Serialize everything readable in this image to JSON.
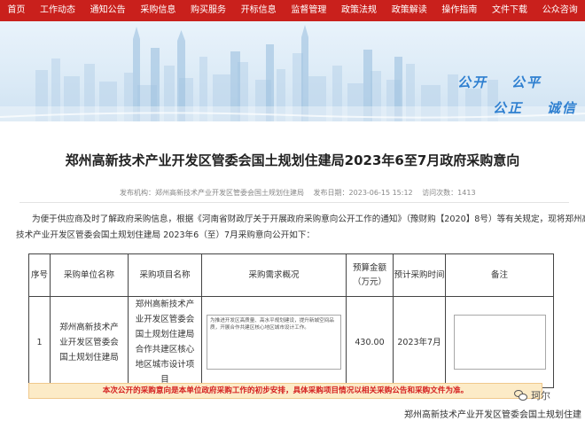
{
  "nav": {
    "items": [
      "首页",
      "工作动态",
      "通知公告",
      "采购信息",
      "购买服务",
      "开标信息",
      "监督管理",
      "政策法规",
      "政策解读",
      "操作指南",
      "文件下载",
      "公众咨询"
    ]
  },
  "banner": {
    "slogan_1": "公开",
    "slogan_2": "公平",
    "slogan_3": "公正",
    "slogan_4": "诚信"
  },
  "article": {
    "title": "郑州高新技术产业开发区管委会国土规划住建局2023年6至7月政府采购意向",
    "publisher": "发布机构：郑州高新技术产业开发区管委会国土规划住建局",
    "date": "发布日期：2023-06-15 15:12",
    "views": "访问次数：1413",
    "intro_line_1": "为便于供应商及时了解政府采购信息，根据《河南省财政厅关于开展政府采购意向公开工作的通知》（豫财购【2020】8号）等有关规定，现将郑州高新",
    "intro_line_2": "技术产业开发区管委会国土规划住建局 2023年6（至）7月采购意向公开如下："
  },
  "table": {
    "headers": {
      "seq": "序号",
      "unit": "采购单位名称",
      "project": "采购项目名称",
      "requirement": "采购需求概况",
      "amount": "预算金额（万元）",
      "time": "预计采购时间",
      "note": "备注"
    },
    "rows": [
      {
        "seq": "1",
        "unit": "郑州高新技术产业开发区管委会国土规划住建局",
        "project": "郑州高新技术产业开发区管委会国土规划住建局合作共建区核心地区城市设计项目",
        "requirement": "为推进开发区高质量、高水平规划建设，提升新城空间品质，开展合作共建区核心地区城市设计工作。",
        "amount": "430.00",
        "time": "2023年7月",
        "note": ""
      }
    ]
  },
  "notice": "本次公开的采购意向是本单位政府采购工作的初步安排，具体采购项目情况以相关采购公告和采购文件为准。",
  "footer": {
    "org": "郑州高新技术产业开发区管委会国土规划住建"
  },
  "watermark": {
    "text": "珂尔"
  }
}
